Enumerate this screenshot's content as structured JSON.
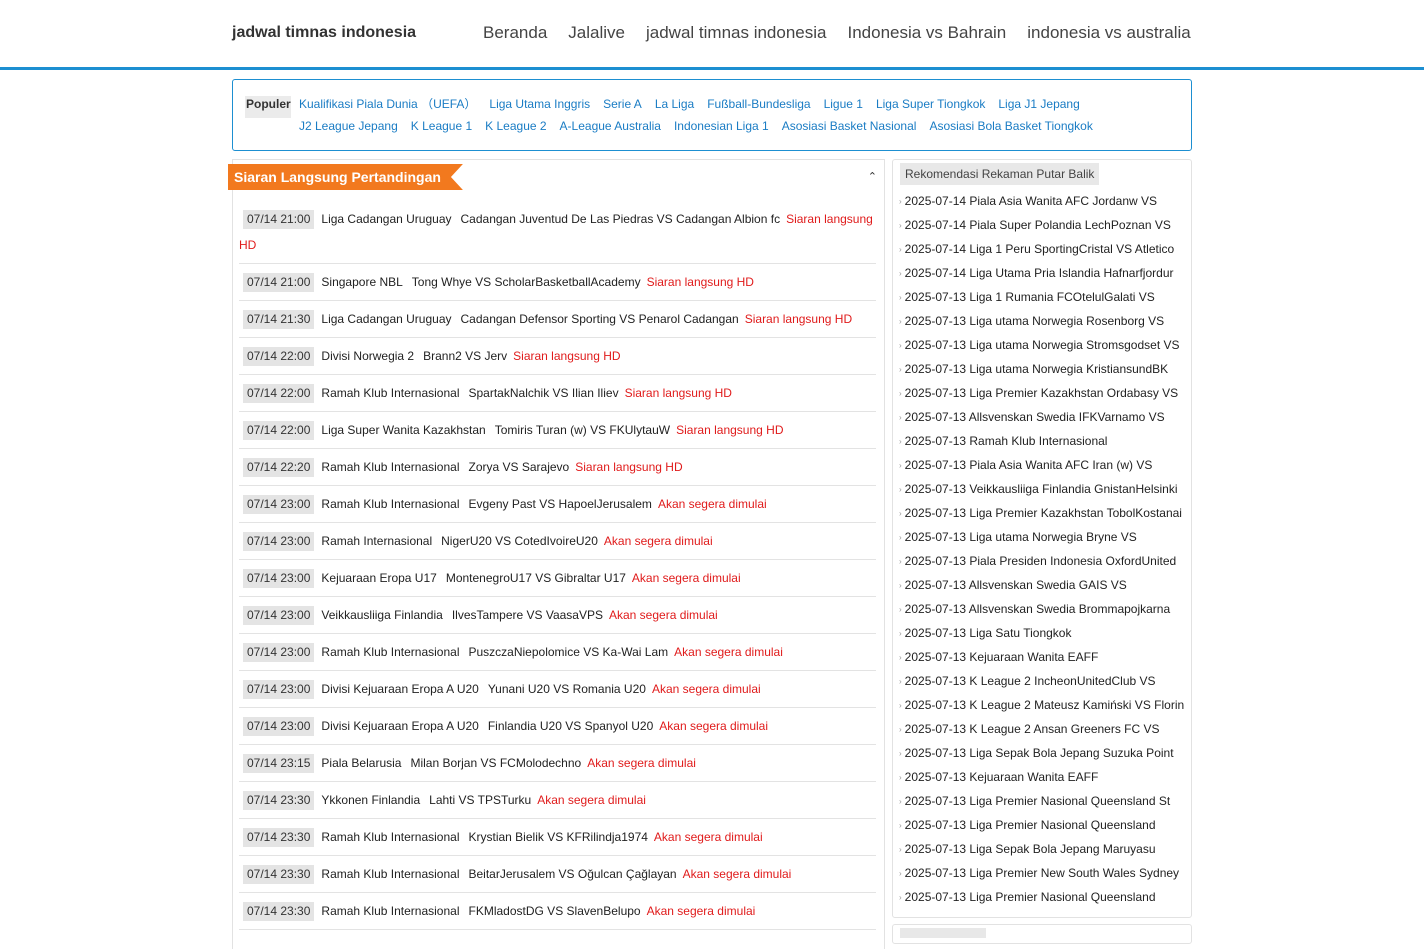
{
  "header": {
    "logo": "jadwal timnas indonesia",
    "nav": [
      "Beranda",
      "Jalalive",
      "jadwal timnas indonesia",
      "Indonesia vs Bahrain",
      "indonesia vs australia"
    ]
  },
  "popular": {
    "label": "Populer",
    "row1": [
      "Kualifikasi Piala Dunia （UEFA）",
      "Liga Utama Inggris",
      "Serie A",
      "La Liga",
      "Fußball-Bundesliga",
      "Ligue 1",
      "Liga Super Tiongkok",
      "Liga J1 Jepang"
    ],
    "row2": [
      "J2 League Jepang",
      "K League 1",
      "K League 2",
      "A-League Australia",
      "Indonesian Liga 1",
      "Asosiasi Basket Nasional",
      "Asosiasi Bola Basket Tiongkok"
    ]
  },
  "live": {
    "title": "Siaran Langsung Pertandingan",
    "collapse_icon": "⌃",
    "matches": [
      {
        "time": "07/14 21:00",
        "league": "Liga Cadangan Uruguay",
        "teams": "Cadangan Juventud De Las Piedras VS Cadangan Albion fc",
        "status": "Siaran langsung HD"
      },
      {
        "time": "07/14 21:00",
        "league": "Singapore NBL",
        "teams": "Tong Whye VS ScholarBasketballAcademy",
        "status": "Siaran langsung HD"
      },
      {
        "time": "07/14 21:30",
        "league": "Liga Cadangan Uruguay",
        "teams": "Cadangan Defensor Sporting VS Penarol Cadangan",
        "status": "Siaran langsung HD"
      },
      {
        "time": "07/14 22:00",
        "league": "Divisi Norwegia 2",
        "teams": "Brann2 VS Jerv",
        "status": "Siaran langsung HD"
      },
      {
        "time": "07/14 22:00",
        "league": "Ramah Klub Internasional",
        "teams": "SpartakNalchik VS Ilian Iliev",
        "status": "Siaran langsung HD"
      },
      {
        "time": "07/14 22:00",
        "league": "Liga Super Wanita Kazakhstan",
        "teams": "Tomiris Turan (w) VS FKUlytauW",
        "status": "Siaran langsung HD"
      },
      {
        "time": "07/14 22:20",
        "league": "Ramah Klub Internasional",
        "teams": "Zorya VS Sarajevo",
        "status": "Siaran langsung HD"
      },
      {
        "time": "07/14 23:00",
        "league": "Ramah Klub Internasional",
        "teams": "Evgeny Past VS HapoelJerusalem",
        "status": "Akan segera dimulai"
      },
      {
        "time": "07/14 23:00",
        "league": "Ramah Internasional",
        "teams": "NigerU20 VS CotedIvoireU20",
        "status": "Akan segera dimulai"
      },
      {
        "time": "07/14 23:00",
        "league": "Kejuaraan Eropa U17",
        "teams": "MontenegroU17 VS Gibraltar U17",
        "status": "Akan segera dimulai"
      },
      {
        "time": "07/14 23:00",
        "league": "Veikkausliiga Finlandia",
        "teams": "IlvesTampere VS VaasaVPS",
        "status": "Akan segera dimulai"
      },
      {
        "time": "07/14 23:00",
        "league": "Ramah Klub Internasional",
        "teams": "PuszczaNiepolomice VS Ka-Wai Lam",
        "status": "Akan segera dimulai"
      },
      {
        "time": "07/14 23:00",
        "league": "Divisi Kejuaraan Eropa A U20",
        "teams": "Yunani U20 VS Romania U20",
        "status": "Akan segera dimulai"
      },
      {
        "time": "07/14 23:00",
        "league": "Divisi Kejuaraan Eropa A U20",
        "teams": "Finlandia U20 VS Spanyol U20",
        "status": "Akan segera dimulai"
      },
      {
        "time": "07/14 23:15",
        "league": "Piala Belarusia",
        "teams": "Milan Borjan VS FCMolodechno",
        "status": "Akan segera dimulai"
      },
      {
        "time": "07/14 23:30",
        "league": "Ykkonen Finlandia",
        "teams": "Lahti VS TPSTurku",
        "status": "Akan segera dimulai"
      },
      {
        "time": "07/14 23:30",
        "league": "Ramah Klub Internasional",
        "teams": "Krystian Bielik VS KFRilindja1974",
        "status": "Akan segera dimulai"
      },
      {
        "time": "07/14 23:30",
        "league": "Ramah Klub Internasional",
        "teams": "BeitarJerusalem VS Oğulcan Çağlayan",
        "status": "Akan segera dimulai"
      },
      {
        "time": "07/14 23:30",
        "league": "Ramah Klub Internasional",
        "teams": "FKMladostDG VS SlavenBelupo",
        "status": "Akan segera dimulai"
      }
    ]
  },
  "recommend": {
    "title": "Rekomendasi Rekaman Putar Balik",
    "items": [
      "2025-07-14 Piala Asia Wanita AFC Jordanw VS",
      "2025-07-14 Piala Super Polandia LechPoznan VS",
      "2025-07-14 Liga 1 Peru SportingCristal VS Atletico",
      "2025-07-14 Liga Utama Pria Islandia Hafnarfjordur",
      "2025-07-13 Liga 1 Rumania FCOtelulGalati VS",
      "2025-07-13 Liga utama Norwegia Rosenborg VS",
      "2025-07-13 Liga utama Norwegia Stromsgodset VS",
      "2025-07-13 Liga utama Norwegia KristiansundBK",
      "2025-07-13 Liga Premier Kazakhstan Ordabasy VS",
      "2025-07-13 Allsvenskan Swedia IFKVarnamo VS",
      "2025-07-13 Ramah Klub Internasional",
      "2025-07-13 Piala Asia Wanita AFC Iran (w) VS",
      "2025-07-13 Veikkausliiga Finlandia GnistanHelsinki",
      "2025-07-13 Liga Premier Kazakhstan TobolKostanai",
      "2025-07-13 Liga utama Norwegia Bryne VS",
      "2025-07-13 Piala Presiden Indonesia OxfordUnited",
      "2025-07-13 Allsvenskan Swedia GAIS VS",
      "2025-07-13 Allsvenskan Swedia Brommapojkarna",
      "2025-07-13 Liga Satu Tiongkok",
      "2025-07-13 Kejuaraan Wanita EAFF",
      "2025-07-13 K League 2 IncheonUnitedClub VS",
      "2025-07-13 K League 2 Mateusz Kamiński VS Florin",
      "2025-07-13 K League 2 Ansan Greeners FC VS",
      "2025-07-13 Liga Sepak Bola Jepang Suzuka Point",
      "2025-07-13 Kejuaraan Wanita EAFF",
      "2025-07-13 Liga Premier Nasional Queensland St",
      "2025-07-13 Liga Premier Nasional Queensland",
      "2025-07-13 Liga Sepak Bola Jepang Maruyasu",
      "2025-07-13 Liga Premier New South Wales Sydney",
      "2025-07-13 Liga Premier Nasional Queensland"
    ]
  },
  "colors": {
    "accent": "#1d8fd1",
    "title_bg": "#f2791e",
    "status": "#e01b1b",
    "link": "#1a7cc4"
  }
}
